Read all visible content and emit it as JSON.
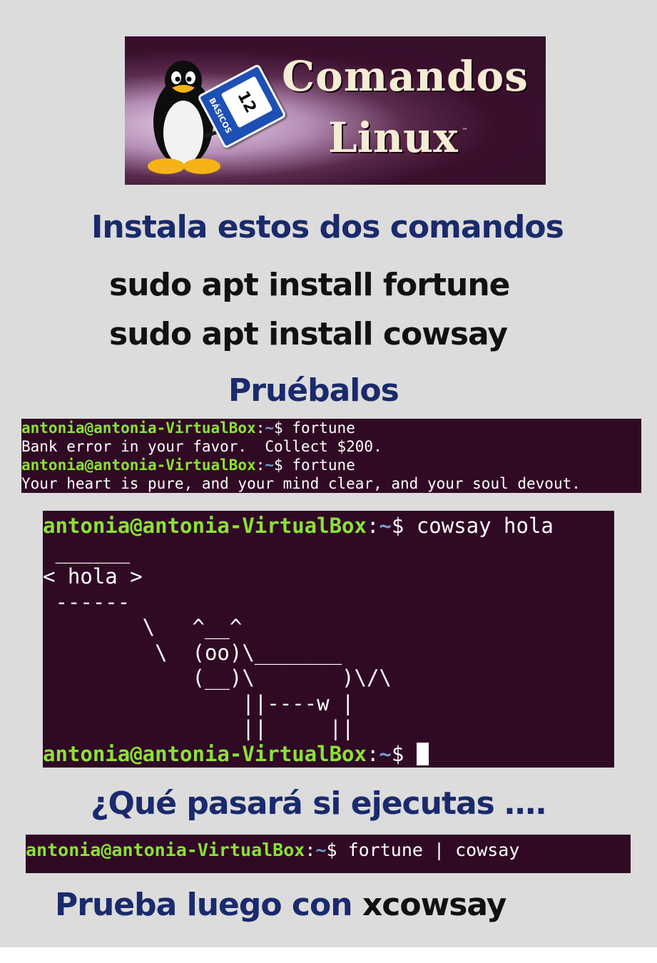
{
  "banner": {
    "title_line1": "Comandos",
    "title_line2": "Linux",
    "trademark": "™",
    "badge_number": "12",
    "badge_text": "BÁSICOS"
  },
  "headings": {
    "instala": "Instala estos dos comandos",
    "cmd1": "sudo apt install fortune",
    "cmd2": "sudo apt install cowsay",
    "pruebalos": "Pruébalos",
    "que": "¿Qué pasará si ejecutas ….",
    "prueba_prefix": "Prueba luego con ",
    "prueba_cmd": "xcowsay"
  },
  "terminal_fortune": {
    "prompt_user": "antonia@antonia-VirtualBox",
    "prompt_sep": ":",
    "prompt_path": "~",
    "prompt_symbol": "$",
    "command1": " fortune",
    "output1": "Bank error in your favor.  Collect $200.",
    "command2": " fortune",
    "output2": "Your heart is pure, and your mind clear, and your soul devout."
  },
  "terminal_cowsay": {
    "prompt_user": "antonia@antonia-VirtualBox",
    "prompt_sep": ":",
    "prompt_path": "~",
    "prompt_symbol": "$",
    "command": " cowsay hola",
    "cow_art": " ______\n< hola >\n ------\n        \\   ^__^\n         \\  (oo)\\_______\n            (__)\\       )\\/\\\n                ||----w |\n                ||     ||"
  },
  "terminal_pipe": {
    "prompt_user": "antonia@antonia-VirtualBox",
    "prompt_sep": ":",
    "prompt_path": "~",
    "prompt_symbol": "$",
    "command": " fortune | cowsay"
  },
  "colors": {
    "heading_blue": "#1a2a6c",
    "terminal_bg": "#300a24",
    "prompt_green": "#8ae234",
    "prompt_blue": "#729fcf",
    "page_bg": "#dcdcdc"
  }
}
